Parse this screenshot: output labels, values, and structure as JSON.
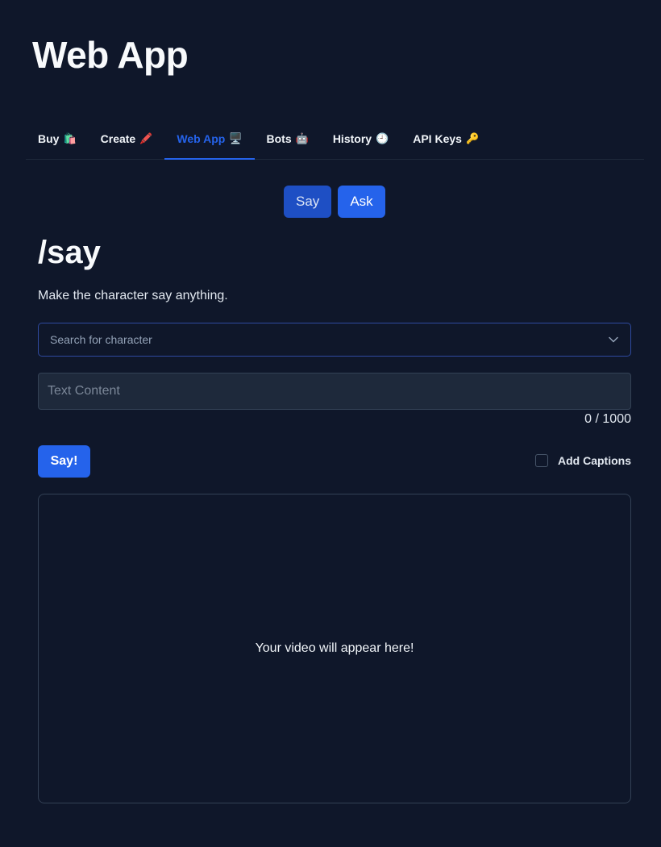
{
  "app": {
    "title": "Web App"
  },
  "tabs": [
    {
      "label": "Buy",
      "emoji": "🛍️",
      "active": false
    },
    {
      "label": "Create",
      "emoji": "🖍️",
      "active": false
    },
    {
      "label": "Web App",
      "emoji": "🖥️",
      "active": true
    },
    {
      "label": "Bots",
      "emoji": "🤖",
      "active": false
    },
    {
      "label": "History",
      "emoji": "🕘",
      "active": false
    },
    {
      "label": "API Keys",
      "emoji": "🔑",
      "active": false
    }
  ],
  "mode": {
    "say_label": "Say",
    "ask_label": "Ask",
    "selected": "Say"
  },
  "command": {
    "title": "/say",
    "description": "Make the character say anything."
  },
  "character_select": {
    "placeholder": "Search for character",
    "value": ""
  },
  "text_input": {
    "placeholder": "Text Content",
    "value": ""
  },
  "char_count": "0 / 1000",
  "submit_label": "Say!",
  "captions": {
    "label": "Add Captions",
    "checked": false
  },
  "video": {
    "placeholder": "Your video will appear here!"
  },
  "colors": {
    "background": "#0f172a",
    "accent": "#2563eb",
    "panel_border": "#334155"
  }
}
